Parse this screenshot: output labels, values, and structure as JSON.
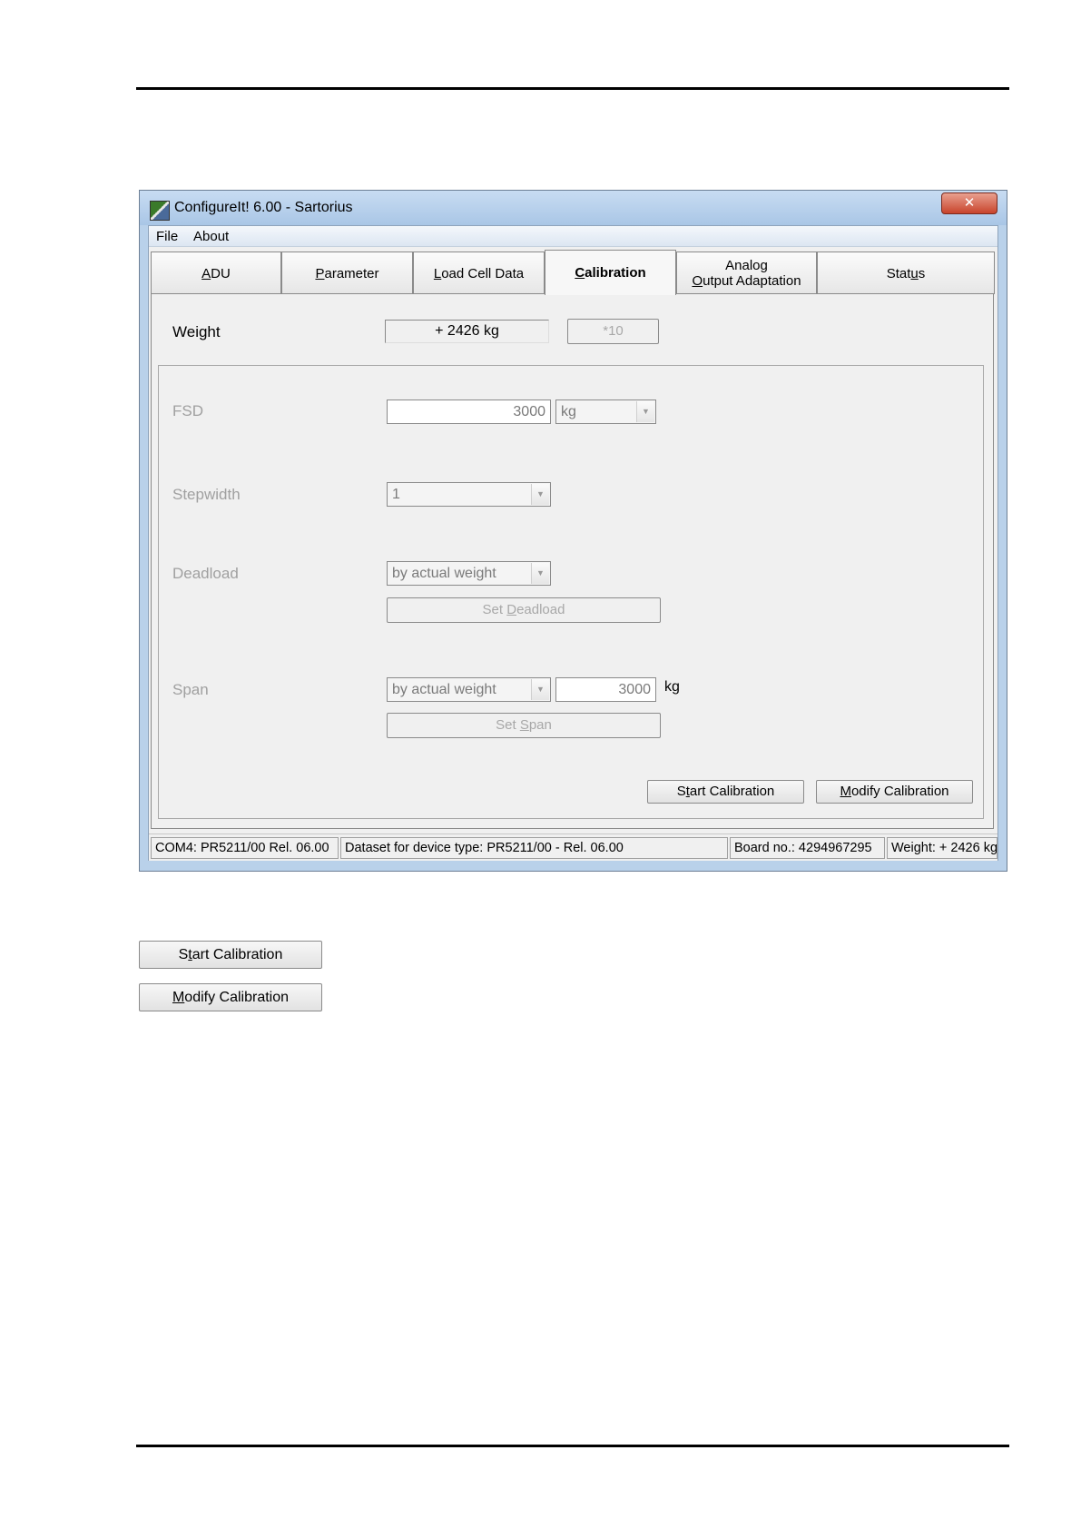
{
  "window": {
    "title": "ConfigureIt!  6.00 -  Sartorius",
    "close_glyph": "✕"
  },
  "menu": [
    "File",
    "About"
  ],
  "tabs": [
    {
      "label": "ADU",
      "underline": "A",
      "rest": "DU"
    },
    {
      "label": "Parameter",
      "underline": "P",
      "rest": "arameter"
    },
    {
      "label": "Load Cell Data",
      "underline": "L",
      "rest": "oad Cell Data"
    },
    {
      "label": "Calibration",
      "underline": "C",
      "rest": "alibration",
      "active": true
    },
    {
      "label_line1": "Analog",
      "label_line2_u": "O",
      "label_line2_rest": "utput Adaptation"
    },
    {
      "pre": "Stat",
      "underline": "u",
      "rest": "s"
    }
  ],
  "calibration": {
    "weight_label": "Weight",
    "weight_value": "+ 2426 kg",
    "x10_label": "*10",
    "fsd_label": "FSD",
    "fsd_value": "3000",
    "fsd_unit": "kg",
    "stepwidth_label": "Stepwidth",
    "stepwidth_value": "1",
    "deadload_label": "Deadload",
    "deadload_mode": "by actual weight",
    "set_deadload": {
      "pre": "Set ",
      "u": "D",
      "rest": "eadload"
    },
    "span_label": "Span",
    "span_mode": "by actual weight",
    "span_value": "3000",
    "span_unit": "kg",
    "set_span": {
      "pre": "Set ",
      "u": "S",
      "rest": "pan"
    },
    "start_calibration": {
      "pre": "S",
      "u": "t",
      "rest": "art Calibration"
    },
    "modify_calibration": {
      "pre": "",
      "u": "M",
      "rest": "odify Calibration"
    }
  },
  "statusbar": {
    "port": "COM4:  PR5211/00 Rel. 06.00",
    "dataset": "Dataset for device type:  PR5211/00  -  Rel. 06.00",
    "board": "Board no.:  4294967295",
    "weight": "Weight:  + 2426 kg"
  },
  "standalone_buttons": {
    "start": {
      "pre": "S",
      "u": "t",
      "rest": "art Calibration"
    },
    "modify": {
      "pre": "",
      "u": "M",
      "rest": "odify Calibration"
    }
  }
}
